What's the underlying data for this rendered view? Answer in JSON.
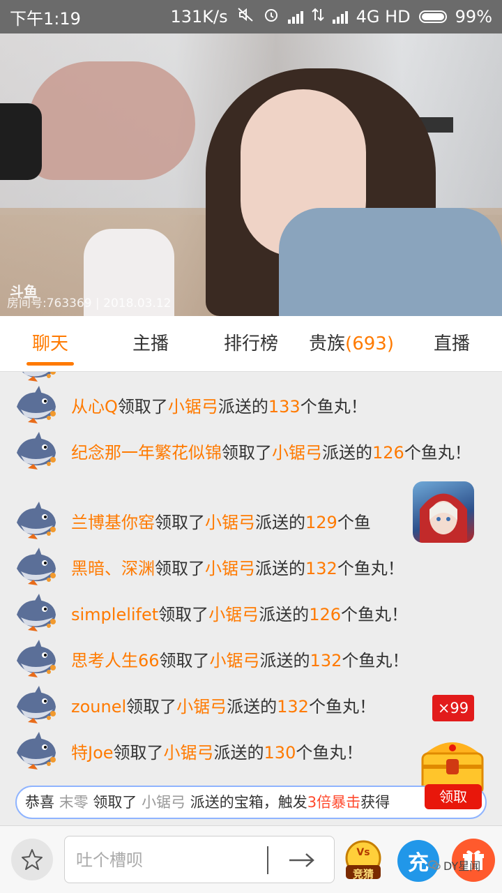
{
  "status_bar": {
    "time": "下午1:19",
    "speed": "131K/s",
    "network": "4G HD",
    "battery": "99%",
    "icons": [
      "mute-icon",
      "alarm-icon",
      "signal-icon",
      "data-arrows-icon",
      "signal-icon",
      "battery-icon"
    ]
  },
  "video": {
    "logo": "斗鱼",
    "watermark": "房间号:763369 | 2018.03.12"
  },
  "tabs": [
    {
      "label": "聊天",
      "active": true
    },
    {
      "label": "主播"
    },
    {
      "label": "排行榜"
    },
    {
      "label": "贵族",
      "count": "(693)"
    },
    {
      "label": "直播"
    }
  ],
  "chat": {
    "messages": [
      {
        "user": "从心Q",
        "verb": "领取了",
        "from": "小锯弓",
        "mid": "派送的",
        "amount": "133",
        "tail": "个鱼丸！"
      },
      {
        "user": "纪念那一年繁花似锦",
        "verb": "领取了",
        "from": "小锯弓",
        "mid": "派送的",
        "amount": "126",
        "tail": "个鱼丸！"
      },
      {
        "user": "兰博基你窑",
        "verb": "领取了",
        "from": "小锯弓",
        "mid": "派送的",
        "amount": "129",
        "tail": "个鱼"
      },
      {
        "user": "黑暗、深渊",
        "verb": "领取了",
        "from": "小锯弓",
        "mid": "派送的",
        "amount": "132",
        "tail": "个鱼丸！"
      },
      {
        "user": "simplelifet",
        "verb": "领取了",
        "from": "小锯弓",
        "mid": "派送的",
        "amount": "126",
        "tail": "个鱼丸！"
      },
      {
        "user": "思考人生66",
        "verb": "领取了",
        "from": "小锯弓",
        "mid": "派送的",
        "amount": "132",
        "tail": "个鱼丸！"
      },
      {
        "user": "zounel",
        "verb": "领取了",
        "from": "小锯弓",
        "mid": "派送的",
        "amount": "132",
        "tail": "个鱼丸！"
      },
      {
        "user": "特Joe",
        "verb": "领取了",
        "from": "小锯弓",
        "mid": "派送的",
        "amount": "130",
        "tail": "个鱼丸！"
      }
    ]
  },
  "gift_banner": {
    "p1": "恭喜",
    "user": "末零",
    "p2": "领取了",
    "from": "小锯弓",
    "p3": "派送的宝箱，触发",
    "highlight": "3倍暴击",
    "p4": "获得"
  },
  "claim_button": "领取",
  "combo_badge": "×99",
  "input": {
    "placeholder": "吐个槽呗",
    "value": ""
  },
  "bottom": {
    "charge_label": "充",
    "guess_label": "竞猜",
    "account_label": "DY星闻"
  },
  "colors": {
    "accent": "#ff7a00",
    "red": "#e21b1b",
    "blue": "#2197e9"
  }
}
